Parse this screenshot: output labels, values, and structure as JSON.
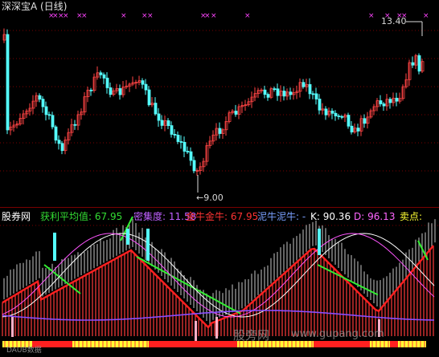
{
  "window": {
    "title": "深深宝A (日线)"
  },
  "price_panel": {
    "high_label": "13.40",
    "low_label": "9.00"
  },
  "indicator_header": [
    {
      "label": "股券网",
      "color": "#ffffff"
    },
    {
      "label": "获利平均值: 67.95",
      "color": "#33dd33"
    },
    {
      "label": "密集度: 11.58",
      "color": "#c060ff"
    },
    {
      "label": "金牛金牛: 67.95",
      "color": "#ff3333"
    },
    {
      "label": "泥牛泥牛: -",
      "color": "#7aa0ff"
    },
    {
      "label": "K: 90.36",
      "color": "#ffffff"
    },
    {
      "label": "D: 96.13",
      "color": "#ff66ff"
    },
    {
      "label": "卖点:",
      "color": "#ffff33"
    }
  ],
  "watermark": {
    "site": "股旁网",
    "url": "www.gupang.com"
  },
  "bottom_left_text": "DAUB数据",
  "colors": {
    "up_candle": "#ff4444",
    "down_candle": "#54ffff",
    "cross_marker": "#ff44ff",
    "grid": "#7a0000",
    "bar_base": "#ffff33"
  }
}
